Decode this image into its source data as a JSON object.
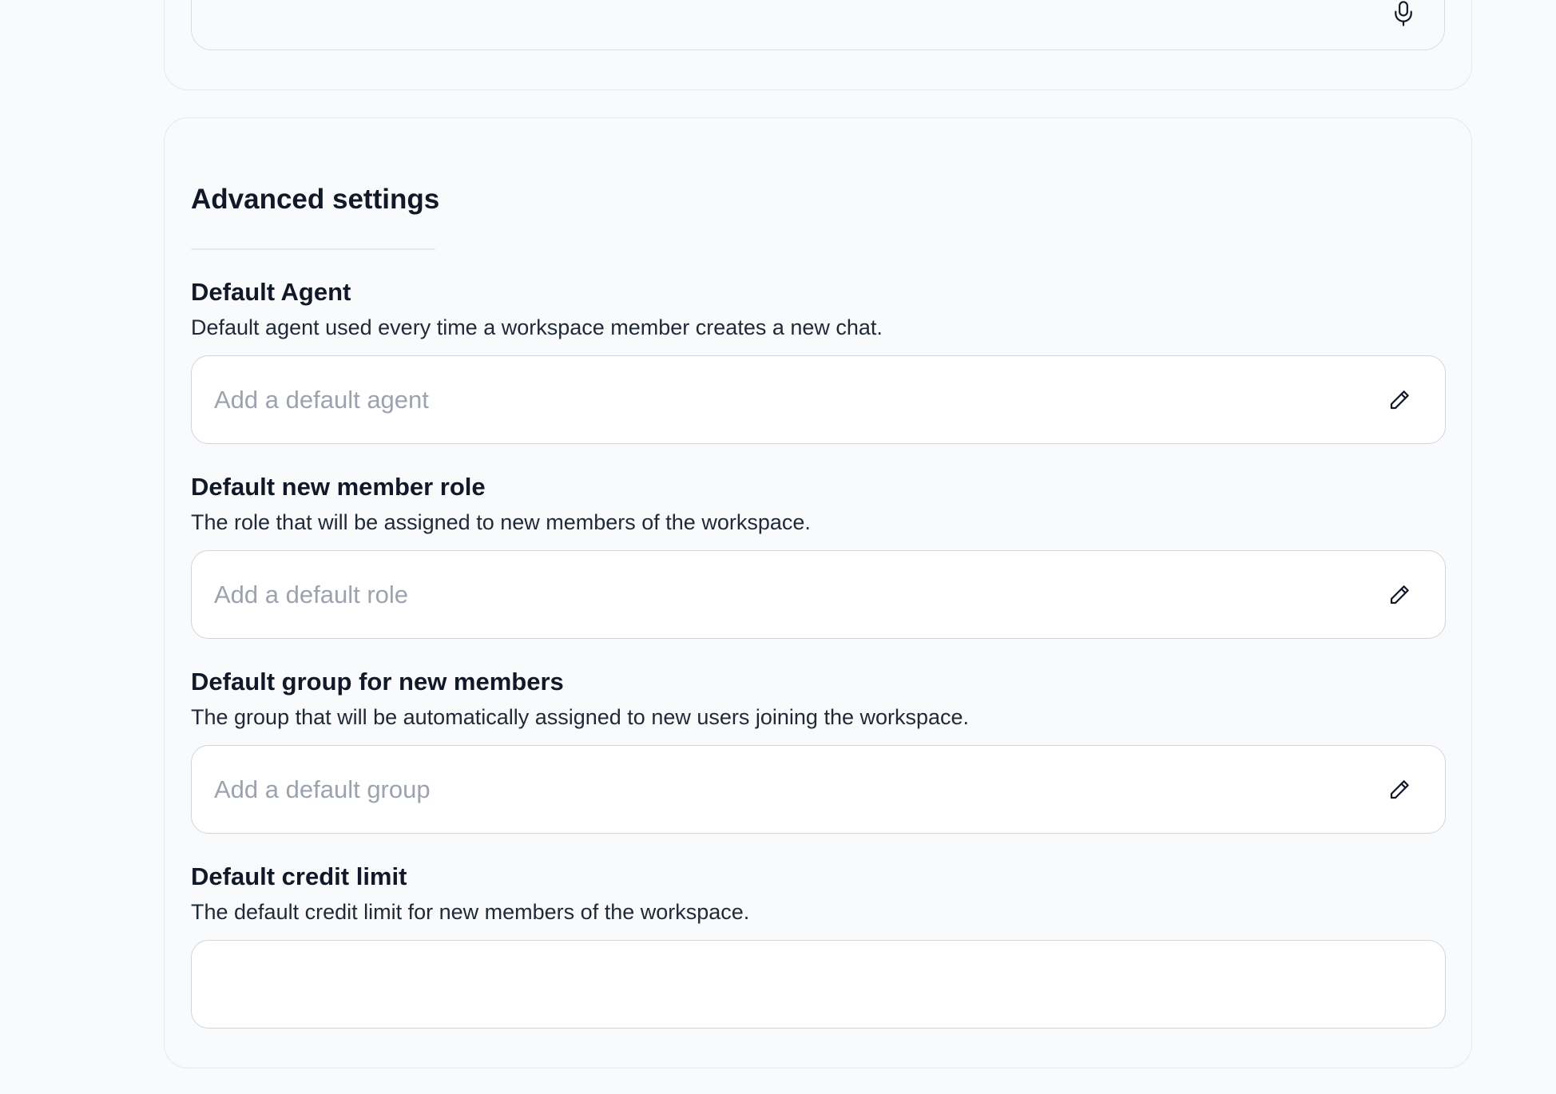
{
  "top_section": {
    "icon": "microphone-icon"
  },
  "advanced": {
    "title": "Advanced settings",
    "fields": [
      {
        "label": "Default Agent",
        "description": "Default agent used every time a workspace member creates a new chat.",
        "placeholder": "Add a default agent",
        "icon": "pencil-icon"
      },
      {
        "label": "Default new member role",
        "description": "The role that will be assigned to new members of the workspace.",
        "placeholder": "Add a default role",
        "icon": "pencil-icon"
      },
      {
        "label": "Default group for new members",
        "description": "The group that will be automatically assigned to new users joining the workspace.",
        "placeholder": "Add a default group",
        "icon": "pencil-icon"
      },
      {
        "label": "Default credit limit",
        "description": "The default credit limit for new members of the workspace.",
        "value": ""
      }
    ]
  },
  "colors": {
    "background": "#f8fafc",
    "border": "#e5e7eb",
    "text": "#111827",
    "placeholder": "#9ca3af"
  }
}
